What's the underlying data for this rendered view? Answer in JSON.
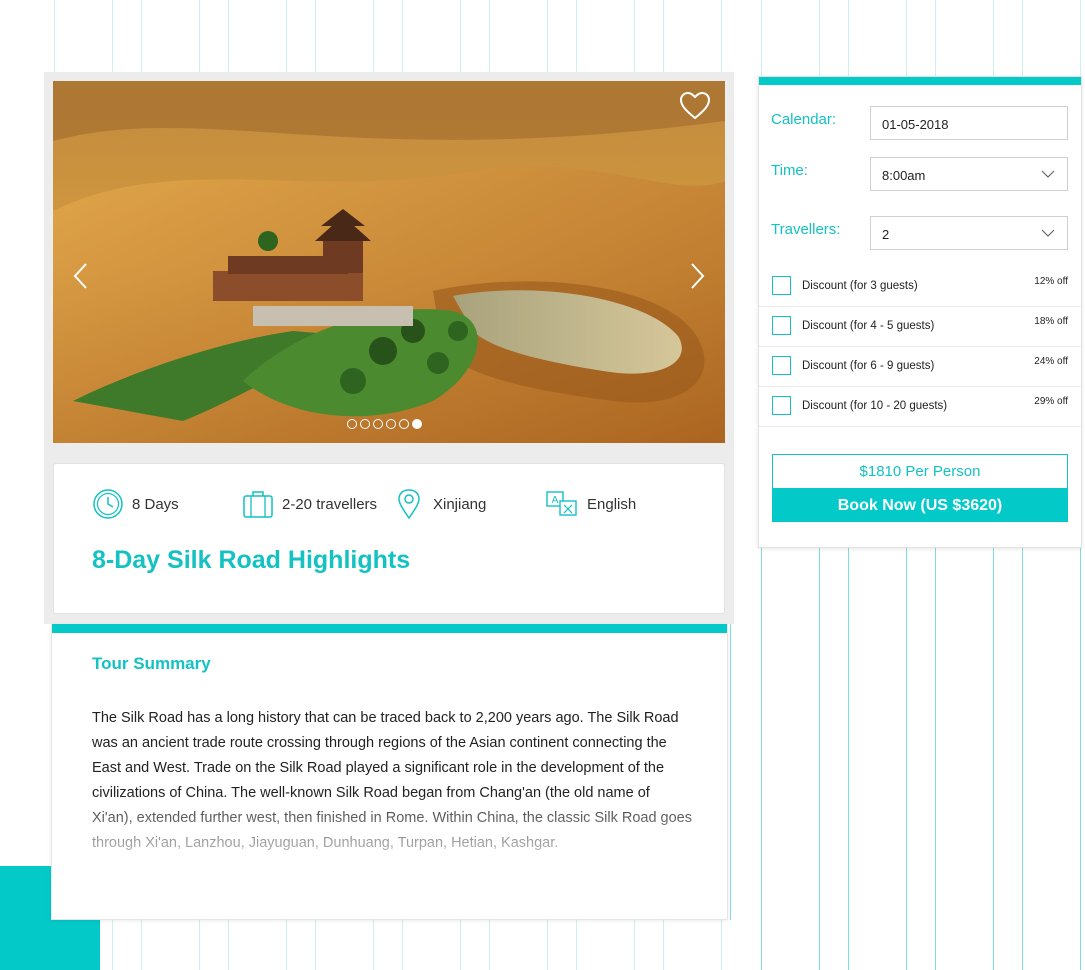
{
  "tour": {
    "title": "8-Day Silk Road Highlights",
    "meta": {
      "duration": "8 Days",
      "group_size": "2-20 travellers",
      "location": "Xinjiang",
      "language": "English"
    },
    "gallery": {
      "slide_count": 6,
      "active_slide": 6
    }
  },
  "summary": {
    "heading": "Tour Summary",
    "body": "The Silk Road has a long history that can be traced back to 2,200 years ago. The Silk Road was an ancient trade route crossing through regions of the Asian continent connecting the East and West. Trade on the Silk Road played a significant role in the development of the civilizations of China. The well-known Silk Road began from Chang'an (the old name of Xi'an), extended further west, then finished in Rome. Within China, the classic Silk Road goes through Xi'an, Lanzhou, Jiayuguan, Dunhuang, Turpan, Hetian, Kashgar."
  },
  "booking": {
    "calendar_label": "Calendar:",
    "calendar_value": "01-05-2018",
    "time_label": "Time:",
    "time_value": "8:00am",
    "travellers_label": "Travellers:",
    "travellers_value": "2",
    "discounts": [
      {
        "label": "Discount (for 3 guests)",
        "off": "12% off"
      },
      {
        "label": "Discount (for 4 - 5 guests)",
        "off": "18% off"
      },
      {
        "label": "Discount (for 6 - 9 guests)",
        "off": "24% off"
      },
      {
        "label": "Discount (for 10 - 20 guests)",
        "off": "29% off"
      }
    ],
    "price_label": "$1810  Per Person",
    "book_label": "Book Now (US $3620)"
  },
  "colors": {
    "accent": "#03c9c9",
    "accent_text": "#14c1c3"
  }
}
